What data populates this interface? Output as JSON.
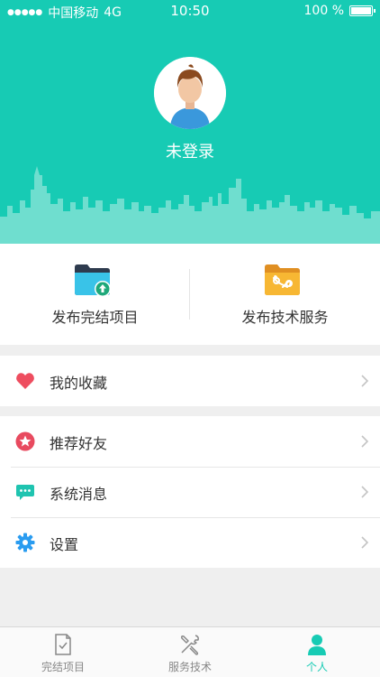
{
  "status_bar": {
    "carrier": "中国移动",
    "network": "4G",
    "time": "10:50",
    "battery": "100 %",
    "signal_dots": "●●●●●"
  },
  "profile": {
    "username": "未登录"
  },
  "publish": [
    {
      "label": "发布完结项目",
      "icon": "folder-upload-icon"
    },
    {
      "label": "发布技术服务",
      "icon": "folder-tools-icon"
    }
  ],
  "menu": {
    "favorites": {
      "label": "我的收藏",
      "icon": "heart-icon"
    },
    "recommend": {
      "label": "推荐好友",
      "icon": "star-icon"
    },
    "messages": {
      "label": "系统消息",
      "icon": "message-icon"
    },
    "settings": {
      "label": "设置",
      "icon": "gear-icon"
    }
  },
  "tabbar": [
    {
      "label": "完结项目",
      "icon": "document-icon"
    },
    {
      "label": "服务技术",
      "icon": "tools-icon"
    },
    {
      "label": "个人",
      "icon": "person-icon",
      "active": true
    }
  ],
  "colors": {
    "accent": "#17cbb4",
    "heart": "#ee4d5f",
    "star": "#e84a5f",
    "message": "#1fc4b0",
    "gear": "#2a9cf0"
  }
}
